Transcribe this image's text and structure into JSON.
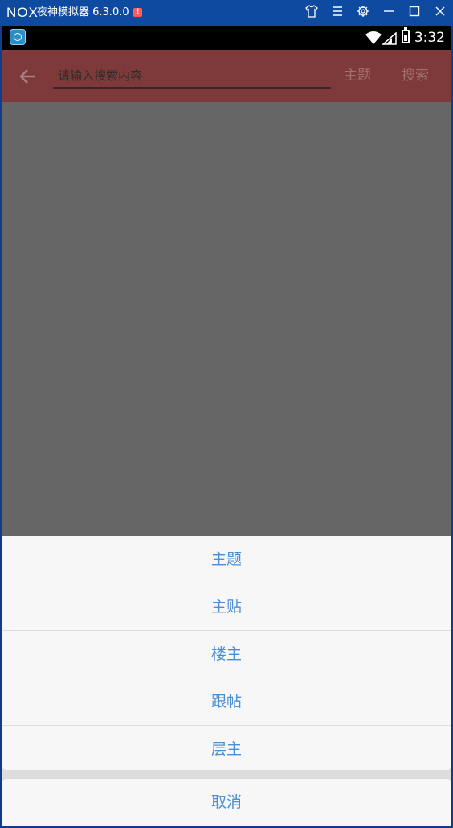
{
  "emulator": {
    "logo": "NOX",
    "title": "夜神模拟器 6.3.0.0",
    "alert": "!",
    "controls": [
      "shirt-icon",
      "menu-icon",
      "settings-icon",
      "minimize-icon",
      "maximize-icon",
      "close-icon"
    ]
  },
  "statusbar": {
    "time": "3:32"
  },
  "appbar": {
    "search_placeholder": "请输入搜索内容",
    "mode_label": "主题",
    "search_label": "搜索",
    "accent_color": "#7e3a3a"
  },
  "sheet": {
    "options": [
      "主题",
      "主贴",
      "楼主",
      "跟帖",
      "层主"
    ],
    "cancel": "取消",
    "text_color": "#4a8fd5"
  }
}
